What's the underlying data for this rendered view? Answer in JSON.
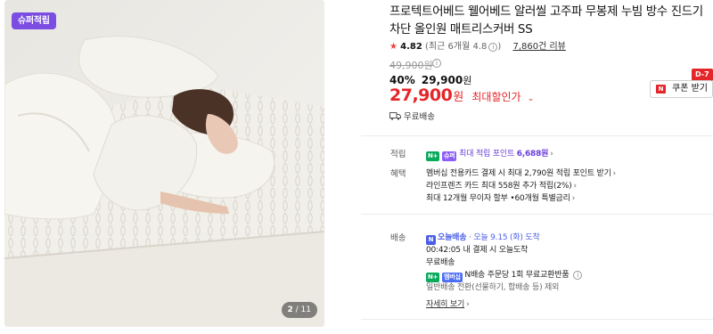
{
  "image": {
    "badge": "슈퍼적립",
    "counter_current": "2",
    "counter_total": "/ 11"
  },
  "product": {
    "title": "프로텍트어베드 웰어베드 알러씰 고주파 무봉제 누빔 방수 진드기 차단 올인원 매트리스커버 SS",
    "rating_star": "★",
    "rating_score": "4.82",
    "rating_sub": "(최근 6개월 4.8",
    "rating_sub_end": ")",
    "review_count": "7,860건 리뷰",
    "original_price": "49,900원",
    "discount_pct": "40%",
    "discount_price": "29,900",
    "discount_won": "원",
    "final_price": "27,900",
    "final_won": "원",
    "final_label": "최대할인가",
    "coupon_tag": "D-7",
    "coupon_label": "쿠폰 받기",
    "coupon_icon": "N",
    "shipping_free": "무료배송"
  },
  "benefits": {
    "points_label": "적립",
    "points_badge_n": "N+",
    "points_badge_extra": "슈퍼",
    "points_text": "최대 적립 포인트",
    "points_value": "6,688원",
    "benefit_label": "혜택",
    "benefit_lines": [
      "멤버십 전용카드 결제 시 최대 2,790원 적립 포인트 받기",
      "라인프렌즈 카드 최대 558원 추가 적립(2%)",
      "최대 12개월 무이자 할부 •60개월 특별금리"
    ]
  },
  "delivery": {
    "label": "배송",
    "today_icon": "N",
    "today_label": "오늘배송",
    "today_eta": "· 오늘 9.15 (화) 도착",
    "countdown": "00:42:05",
    "countdown_text": "내 결제 시 오늘도착",
    "free": "무료배송",
    "exchange_badge_n": "N+",
    "exchange_badge_extra": "멤버십",
    "exchange_text": "N배송 주문당 1회 무료교환반품",
    "exclusion": "일반배송 전환(선물하기, 합배송 등) 제외",
    "detail_link": "자세히 보기"
  },
  "colors": {
    "accent_red": "#e4262a",
    "super_purple": "#7b4de3",
    "naver_green": "#09aa5c"
  }
}
